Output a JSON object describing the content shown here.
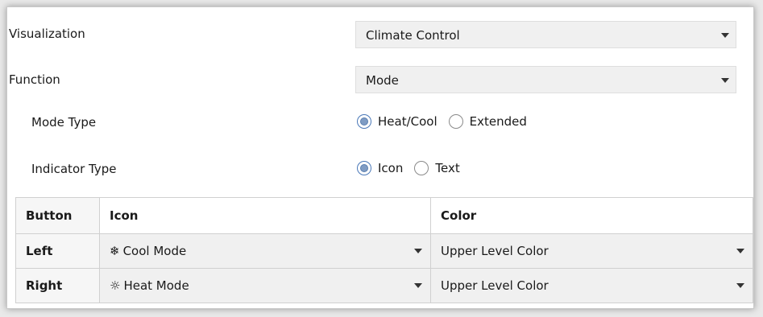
{
  "form": {
    "visualization": {
      "label": "Visualization",
      "value": "Climate Control"
    },
    "function": {
      "label": "Function",
      "value": "Mode"
    },
    "mode_type": {
      "label": "Mode Type",
      "options": [
        "Heat/Cool",
        "Extended"
      ],
      "selected": "Heat/Cool"
    },
    "indicator_type": {
      "label": "Indicator Type",
      "options": [
        "Icon",
        "Text"
      ],
      "selected": "Icon"
    }
  },
  "table": {
    "headers": [
      "Button",
      "Icon",
      "Color"
    ],
    "rows": [
      {
        "button": "Left",
        "icon_glyph": "❄",
        "icon_label": "Cool Mode",
        "color": "Upper Level Color"
      },
      {
        "button": "Right",
        "icon_glyph": "☼",
        "icon_label": "Heat Mode",
        "color": "Upper Level Color"
      }
    ]
  },
  "icons": {
    "cool": "snowflake-icon",
    "heat": "sun-icon"
  },
  "colors": {
    "radio_selected": "#7f9cc4",
    "dropdown_bg": "#f0f0f0"
  }
}
